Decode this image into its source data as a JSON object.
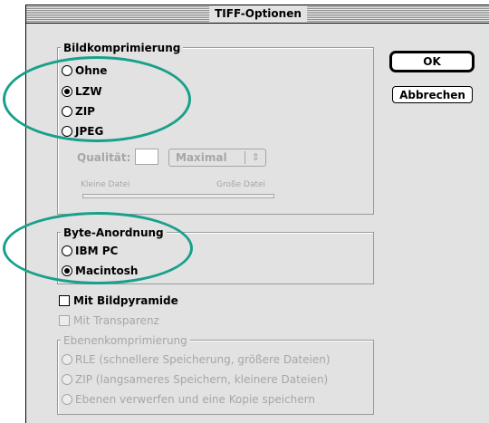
{
  "dialog": {
    "title": "TIFF-Optionen"
  },
  "buttons": {
    "ok": "OK",
    "cancel": "Abbrechen"
  },
  "compression": {
    "legend": "Bildkomprimierung",
    "options": [
      "Ohne",
      "LZW",
      "ZIP",
      "JPEG"
    ],
    "selected": "LZW",
    "quality_label": "Qualität:",
    "quality_value": "",
    "quality_select": "Maximal",
    "slider_min_label": "Kleine Datei",
    "slider_max_label": "Große Datei"
  },
  "byte_order": {
    "legend": "Byte-Anordnung",
    "options": [
      "IBM PC",
      "Macintosh"
    ],
    "selected": "Macintosh"
  },
  "checkboxes": {
    "pyramid": "Mit Bildpyramide",
    "transparency": "Mit Transparenz"
  },
  "layer_compression": {
    "legend": "Ebenenkomprimierung",
    "options": [
      "RLE (schnellere Speicherung, größere Dateien)",
      "ZIP (langsameres Speichern, kleinere Dateien)",
      "Ebenen verwerfen und eine Kopie speichern"
    ]
  },
  "annotations": {
    "color": "#18a08a"
  }
}
